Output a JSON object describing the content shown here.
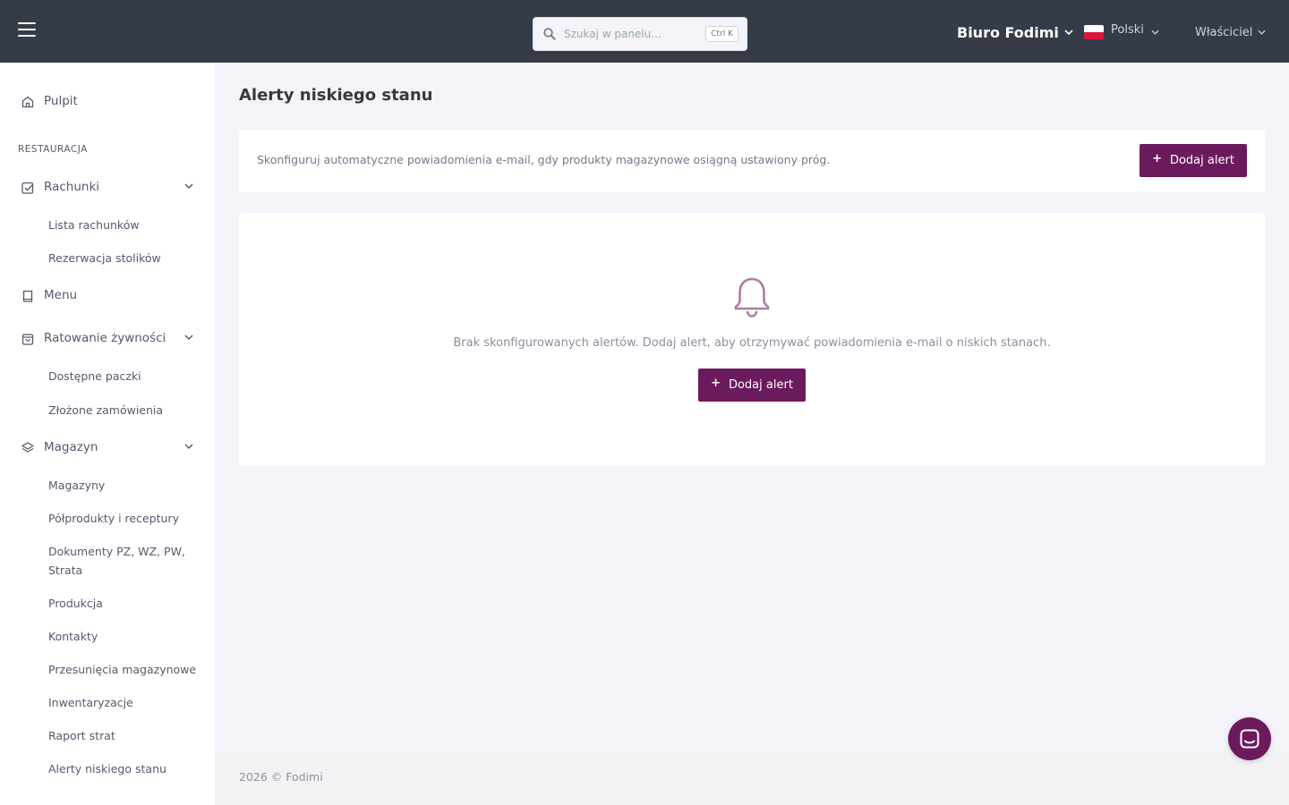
{
  "topbar": {
    "search_placeholder": "Szukaj w panelu...",
    "search_shortcut": "Ctrl K",
    "organization": "Biuro Fodimi",
    "language": "Polski",
    "user_role": "Właściciel"
  },
  "sidebar": {
    "dashboard": "Pulpit",
    "section_title": "RESTAURACJA",
    "groups": [
      {
        "label": "Rachunki",
        "items": [
          "Lista rachunków",
          "Rezerwacja stolików"
        ]
      },
      {
        "label": "Menu"
      },
      {
        "label": "Ratowanie żywności",
        "items": [
          "Dostępne paczki",
          "Złożone zamówienia"
        ]
      },
      {
        "label": "Magazyn",
        "items": [
          "Magazyny",
          "Półprodukty i receptury",
          "Dokumenty PZ, WZ, PW, Strata",
          "Produkcja",
          "Kontakty",
          "Przesunięcia magazynowe",
          "Inwentaryzacje",
          "Raport strat",
          "Alerty niskiego stanu"
        ]
      }
    ]
  },
  "main": {
    "title": "Alerty niskiego stanu",
    "info_text": "Skonfiguruj automatyczne powiadomienia e-mail, gdy produkty magazynowe osiągną ustawiony próg.",
    "add_button": "Dodaj alert",
    "empty_text": "Brak skonfigurowanych alertów. Dodaj alert, aby otrzymywać powiadomienia e-mail o niskich stanach.",
    "empty_add_button": "Dodaj alert"
  },
  "footer": {
    "text": "2026 © Fodimi"
  },
  "colors": {
    "topbar": "#353c48",
    "accent": "#6c1a5e",
    "bell": "#b07aa8"
  }
}
